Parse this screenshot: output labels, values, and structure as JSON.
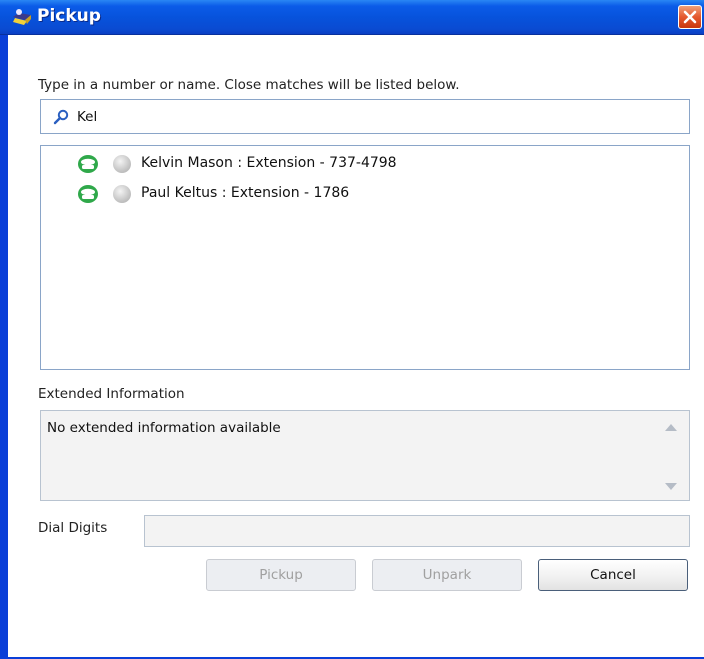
{
  "window": {
    "title": "Pickup"
  },
  "prompt": "Type in a number or name.  Close matches will be listed below.",
  "search": {
    "value": "Kel",
    "icon": "search-icon"
  },
  "results": [
    {
      "text": "Kelvin Mason : Extension - 737-4798"
    },
    {
      "text": "Paul Keltus : Extension - 1786"
    }
  ],
  "extended": {
    "label": "Extended Information",
    "text": "No extended information available"
  },
  "dial": {
    "label": "Dial Digits",
    "value": ""
  },
  "buttons": {
    "pickup": "Pickup",
    "unpark": "Unpark",
    "cancel": "Cancel"
  },
  "colors": {
    "titlebar": "#0b5be8",
    "close": "#e5582e",
    "phone_green": "#2fa84a",
    "presence_gray": "#c9c9c9"
  }
}
